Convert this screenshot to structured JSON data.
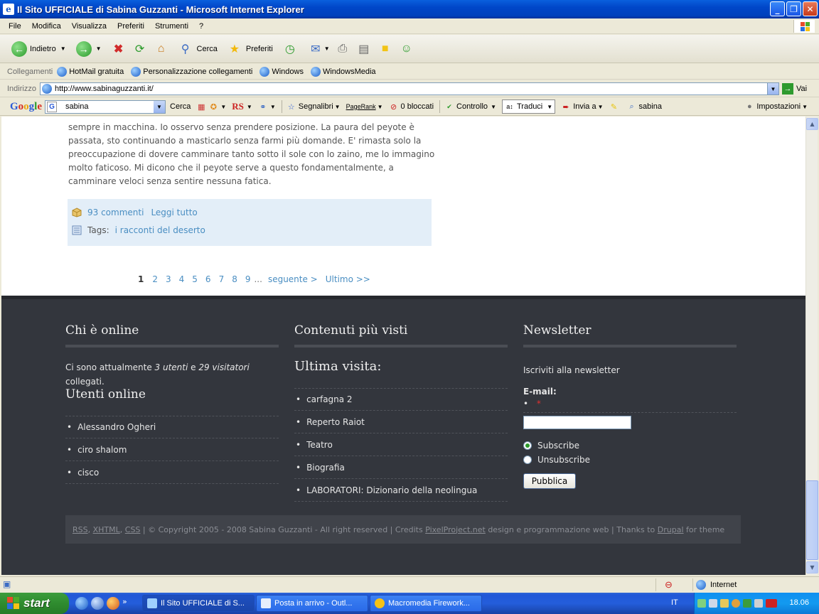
{
  "window": {
    "title": "Il Sito UFFICIALE di Sabina Guzzanti - Microsoft Internet Explorer",
    "controls": [
      "_",
      "❐",
      "✕"
    ]
  },
  "menu": [
    "File",
    "Modifica",
    "Visualizza",
    "Preferiti",
    "Strumenti",
    "?"
  ],
  "toolbar": {
    "back": "Indietro",
    "search": "Cerca",
    "favorites": "Preferiti"
  },
  "links": {
    "title": "Collegamenti",
    "items": [
      "HotMail gratuita",
      "Personalizzazione collegamenti",
      "Windows",
      "WindowsMedia"
    ]
  },
  "address": {
    "title": "Indirizzo",
    "url": "http://www.sabinaguzzanti.it/",
    "go": "Vai"
  },
  "google_bar": {
    "query": "sabina",
    "search": "Cerca",
    "rs": "RS",
    "bookmarks": "Segnalibri",
    "pagerank": "PageRank",
    "blocked": "0 bloccati",
    "check": "Controllo",
    "translate": "Traduci",
    "send": "Invia a",
    "highlight": "sabina",
    "settings": "Impostazioni"
  },
  "article": {
    "text": "sempre in macchina. Io osservo senza prendere posizione. La paura del peyote è passata, sto continuando a masticarlo senza farmi più domande. E' rimasta solo la preoccupazione di dovere camminare tanto sotto il sole con lo zaino, me lo immagino molto faticoso. Mi dicono che il peyote serve a questo fondamentalmente, a camminare veloci senza sentire nessuna fatica.",
    "comments": "93 commenti",
    "read_all": "Leggi tutto",
    "tags_label": "Tags:",
    "tag": "i racconti del deserto"
  },
  "pager": {
    "current": "1",
    "pages": [
      "2",
      "3",
      "4",
      "5",
      "6",
      "7",
      "8",
      "9"
    ],
    "dots": "...",
    "next": "seguente >",
    "last": "Ultimo >>"
  },
  "footer": {
    "online": {
      "title": "Chi è online",
      "text_pre": "Ci sono attualmente ",
      "users": "3 utenti",
      "text_mid": " e ",
      "visitors": "29 visitatori",
      "text_post": " collegati.",
      "subtitle": "Utenti online",
      "users_list": [
        "Alessandro Ogheri",
        "ciro shalom",
        "cisco"
      ]
    },
    "popular": {
      "title": "Contenuti più visti",
      "subtitle": "Ultima visita:",
      "items": [
        "carfagna 2",
        "Reperto Raiot",
        "Teatro",
        "Biografia",
        "LABORATORI: Dizionario della neolingua"
      ]
    },
    "newsletter": {
      "title": "Newsletter",
      "subscribe_text": "Iscriviti alla newsletter",
      "email_label": "E-mail:",
      "required": "*",
      "opt_subscribe": "Subscribe",
      "opt_unsubscribe": "Unsubscribe",
      "submit": "Pubblica"
    },
    "copyright": {
      "rss": "RSS",
      "xhtml": "XHTML",
      "css": "CSS",
      "text": " | © Copyright 2005 - 2008 Sabina Guzzanti - All right reserved | Credits ",
      "credit_link": "PixelProject.net",
      "text2": " design e programmazione web | Thanks to ",
      "drupal": "Drupal",
      "text3": " for theme"
    }
  },
  "status": {
    "zone": "Internet"
  },
  "taskbar": {
    "start": "start",
    "tasks": [
      "Il Sito UFFICIALE di S...",
      "Posta in arrivo - Outl...",
      "Macromedia Firework..."
    ],
    "lang": "IT",
    "clock": "18.06"
  }
}
